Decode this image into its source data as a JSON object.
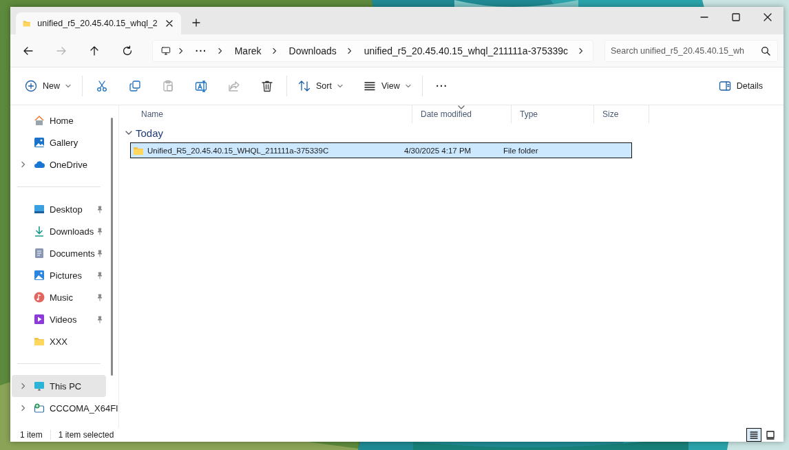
{
  "window": {
    "tab": {
      "title": "unified_r5_20.45.40.15_whql_2"
    }
  },
  "nav": [
    {
      "kind": "back",
      "disabled": false
    },
    {
      "kind": "forward",
      "disabled": true
    },
    {
      "kind": "up",
      "disabled": false
    },
    {
      "kind": "refresh",
      "disabled": false
    }
  ],
  "address": {
    "overflow": "···",
    "path": [
      "Marek",
      "Downloads",
      "unified_r5_20.45.40.15_whql_211111a-375339c"
    ]
  },
  "search": {
    "placeholder": "Search unified_r5_20.45.40.15_wh"
  },
  "toolbar": {
    "new": "New",
    "actions": [
      {
        "kind": "cut",
        "disabled": false
      },
      {
        "kind": "copy",
        "disabled": false
      },
      {
        "kind": "paste",
        "disabled": true
      },
      {
        "kind": "rename",
        "disabled": false
      },
      {
        "kind": "share",
        "disabled": true
      },
      {
        "kind": "delete",
        "disabled": false
      }
    ],
    "sort": "Sort",
    "view": "View",
    "more": "···",
    "details": "Details"
  },
  "sidebar": {
    "groups": [
      {
        "items": [
          {
            "kind": "home",
            "label": "Home",
            "expandable": false,
            "pinned": false,
            "selected": false
          },
          {
            "kind": "gallery",
            "label": "Gallery",
            "expandable": false,
            "pinned": false,
            "selected": false
          },
          {
            "kind": "onedrive",
            "label": "OneDrive",
            "expandable": true,
            "pinned": false,
            "selected": false
          }
        ]
      },
      {
        "items": [
          {
            "kind": "desktop",
            "label": "Desktop",
            "expandable": false,
            "pinned": true,
            "selected": false
          },
          {
            "kind": "downloads",
            "label": "Downloads",
            "expandable": false,
            "pinned": true,
            "selected": false
          },
          {
            "kind": "documents",
            "label": "Documents",
            "expandable": false,
            "pinned": true,
            "selected": false
          },
          {
            "kind": "pictures",
            "label": "Pictures",
            "expandable": false,
            "pinned": true,
            "selected": false
          },
          {
            "kind": "music",
            "label": "Music",
            "expandable": false,
            "pinned": true,
            "selected": false
          },
          {
            "kind": "videos",
            "label": "Videos",
            "expandable": false,
            "pinned": true,
            "selected": false
          },
          {
            "kind": "folder",
            "label": "XXX",
            "expandable": false,
            "pinned": false,
            "selected": false
          }
        ]
      },
      {
        "items": [
          {
            "kind": "pc",
            "label": "This PC",
            "expandable": true,
            "pinned": false,
            "selected": true
          },
          {
            "kind": "drive",
            "label": "CCCOMA_X64FI",
            "expandable": true,
            "pinned": false,
            "selected": false
          }
        ]
      }
    ]
  },
  "columns": [
    {
      "label": "Name",
      "sorted": false
    },
    {
      "label": "Date modified",
      "sorted": true
    },
    {
      "label": "Type",
      "sorted": false
    },
    {
      "label": "Size",
      "sorted": false
    }
  ],
  "groups": [
    {
      "label": "Today",
      "expanded": true,
      "rows": [
        {
          "name": "Unified_R5_20.45.40.15_WHQL_211111a-375339C",
          "date": "4/30/2025 4:17 PM",
          "type": "File folder",
          "selected": true
        }
      ]
    }
  ],
  "status": {
    "count": "1 item",
    "selection": "1 item selected"
  },
  "view_modes": [
    {
      "kind": "details",
      "selected": true
    },
    {
      "kind": "tiles",
      "selected": false
    }
  ]
}
